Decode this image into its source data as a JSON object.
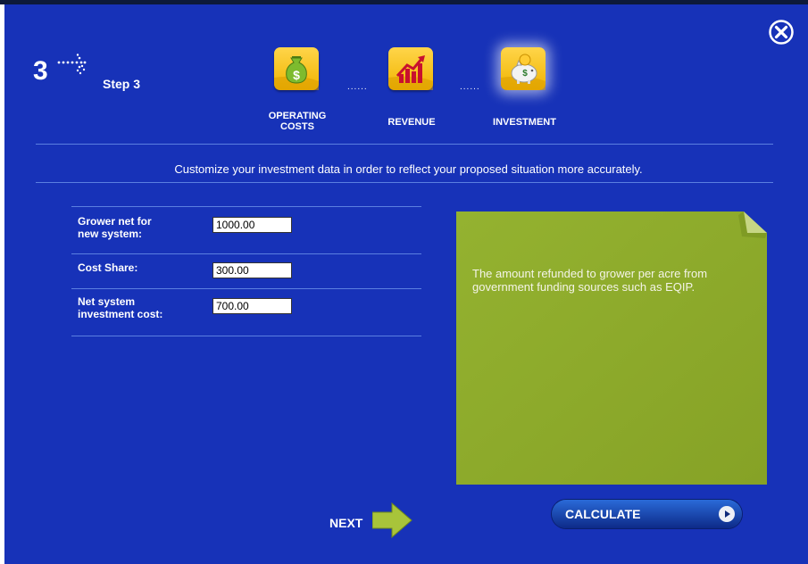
{
  "header": {
    "step_number": "3",
    "step_label": "Step 3",
    "tabs": [
      {
        "label": "OPERATING COSTS",
        "icon": "money-bag-icon"
      },
      {
        "label": "REVENUE",
        "icon": "growth-chart-icon"
      },
      {
        "label": "INVESTMENT",
        "icon": "piggy-bank-icon",
        "active": true
      }
    ],
    "separator": "......"
  },
  "instruction": "Customize your investment data in order to reflect your proposed situation more accurately.",
  "form": {
    "rows": [
      {
        "label_line1": "Grower net for",
        "label_line2": "new system:",
        "value": "1000.00"
      },
      {
        "label_line1": "Cost Share:",
        "label_line2": "",
        "value": "300.00"
      },
      {
        "label_line1": "Net system",
        "label_line2": "investment cost:",
        "value": "700.00"
      }
    ]
  },
  "note": {
    "text": "The amount refunded to grower per acre from government funding sources such as EQIP."
  },
  "actions": {
    "next_label": "NEXT",
    "calculate_label": "CALCULATE"
  },
  "colors": {
    "background": "#1732b8",
    "tile": "#f0b400",
    "note": "#8fae2b",
    "next_arrow": "#a8c43a"
  }
}
